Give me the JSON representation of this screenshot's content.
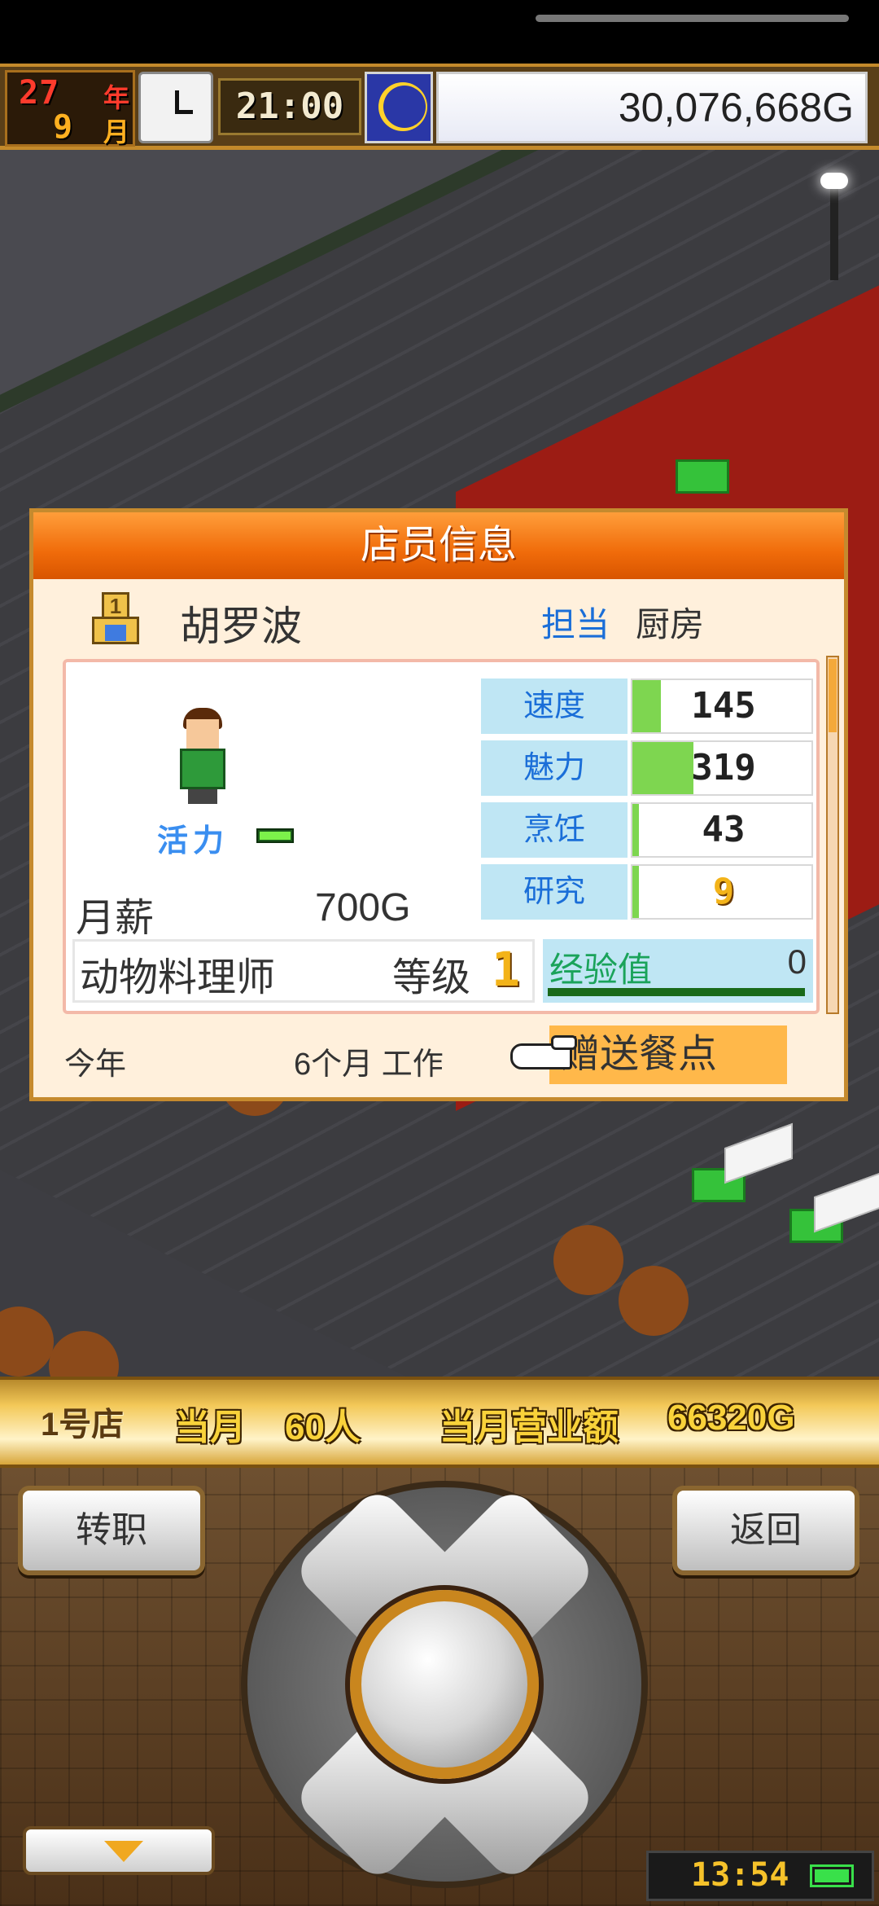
{
  "hud": {
    "year_num": "27",
    "year_unit": "年",
    "month_num": "9",
    "month_unit": "月",
    "time": "21:00",
    "money": "30,076,668G",
    "night_icon": "moon-icon"
  },
  "dialog": {
    "title": "店员信息",
    "staff_name": "胡罗波",
    "assign_label": "担当",
    "assign_value": "厨房",
    "vigor_label": "活力",
    "vigor_level": 1.0,
    "salary_label": "月薪",
    "salary_value": "700G",
    "stats": [
      {
        "name": "速度",
        "value": "145",
        "fill": 0.16
      },
      {
        "name": "魅力",
        "value": "319",
        "fill": 0.34
      },
      {
        "name": "烹饪",
        "value": "43",
        "fill": 0.03
      },
      {
        "name": "研究",
        "value": "9",
        "fill": 0.02
      }
    ],
    "job_title": "动物料理师",
    "level_label": "等级",
    "level_value": "1",
    "exp_label": "经验值",
    "exp_value": "0",
    "year_label": "今年",
    "work_label": "6个月 工作",
    "gift_button": "赠送餐点"
  },
  "infobar": {
    "store": "1号店",
    "month": "当月",
    "customers": "60人",
    "sales_label": "当月营业额",
    "sales": "66320G"
  },
  "controls": {
    "left_button": "转职",
    "right_button": "返回",
    "game_time": "13:54",
    "battery_level": 1.0
  }
}
